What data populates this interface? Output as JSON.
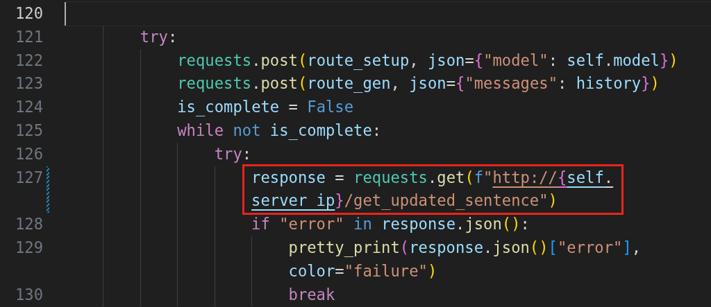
{
  "lines": [
    {
      "number": "120",
      "current": true,
      "modified": false,
      "highlighted": false
    },
    {
      "number": "121",
      "current": false,
      "modified": false,
      "highlighted": false,
      "rows": [
        {
          "tokens": [
            {
              "kind": "kw",
              "text": "try"
            },
            {
              "kind": "p",
              "text": ":"
            }
          ]
        }
      ],
      "children": [
        {
          "number": "122",
          "current": false,
          "modified": false,
          "highlighted": false,
          "rows": [
            {
              "tokens": [
                {
                  "kind": "cls",
                  "text": "requests"
                },
                {
                  "kind": "p",
                  "text": "."
                },
                {
                  "kind": "fn",
                  "text": "post"
                },
                {
                  "kind": "b1",
                  "text": "("
                },
                {
                  "kind": "var",
                  "text": "route_setup"
                },
                {
                  "kind": "p",
                  "text": ", "
                },
                {
                  "kind": "var",
                  "text": "json"
                },
                {
                  "kind": "p",
                  "text": "="
                },
                {
                  "kind": "b2",
                  "text": "{"
                },
                {
                  "kind": "str",
                  "text": "\"model\""
                },
                {
                  "kind": "p",
                  "text": ": "
                },
                {
                  "kind": "var",
                  "text": "self"
                },
                {
                  "kind": "p",
                  "text": "."
                },
                {
                  "kind": "var",
                  "text": "model"
                },
                {
                  "kind": "b2",
                  "text": "}"
                },
                {
                  "kind": "b1",
                  "text": ")"
                }
              ]
            }
          ]
        },
        {
          "number": "123",
          "current": false,
          "modified": false,
          "highlighted": false,
          "rows": [
            {
              "tokens": [
                {
                  "kind": "cls",
                  "text": "requests"
                },
                {
                  "kind": "p",
                  "text": "."
                },
                {
                  "kind": "fn",
                  "text": "post"
                },
                {
                  "kind": "b1",
                  "text": "("
                },
                {
                  "kind": "var",
                  "text": "route_gen"
                },
                {
                  "kind": "p",
                  "text": ", "
                },
                {
                  "kind": "var",
                  "text": "json"
                },
                {
                  "kind": "p",
                  "text": "="
                },
                {
                  "kind": "b2",
                  "text": "{"
                },
                {
                  "kind": "str",
                  "text": "\"messages\""
                },
                {
                  "kind": "p",
                  "text": ": "
                },
                {
                  "kind": "var",
                  "text": "history"
                },
                {
                  "kind": "b2",
                  "text": "}"
                },
                {
                  "kind": "b1",
                  "text": ")"
                }
              ]
            }
          ]
        },
        {
          "number": "124",
          "current": false,
          "modified": false,
          "highlighted": false,
          "rows": [
            {
              "tokens": [
                {
                  "kind": "var",
                  "text": "is_complete"
                },
                {
                  "kind": "p",
                  "text": " = "
                },
                {
                  "kind": "const",
                  "text": "False"
                }
              ]
            }
          ]
        },
        {
          "number": "125",
          "current": false,
          "modified": false,
          "highlighted": false,
          "rows": [
            {
              "tokens": [
                {
                  "kind": "kw",
                  "text": "while "
                },
                {
                  "kind": "const",
                  "text": "not "
                },
                {
                  "kind": "var",
                  "text": "is_complete"
                },
                {
                  "kind": "p",
                  "text": ":"
                }
              ]
            }
          ],
          "children": [
            {
              "number": "126",
              "current": false,
              "modified": false,
              "highlighted": false,
              "rows": [
                {
                  "tokens": [
                    {
                      "kind": "kw",
                      "text": "try"
                    },
                    {
                      "kind": "p",
                      "text": ":"
                    }
                  ]
                }
              ],
              "children": [
                {
                  "number": "127",
                  "current": false,
                  "modified": true,
                  "highlighted": true,
                  "rows": [
                    {
                      "tokens": [
                        {
                          "kind": "var",
                          "text": "response"
                        },
                        {
                          "kind": "p",
                          "text": " = "
                        },
                        {
                          "kind": "cls",
                          "text": "requests"
                        },
                        {
                          "kind": "p",
                          "text": "."
                        },
                        {
                          "kind": "fn",
                          "text": "get"
                        },
                        {
                          "kind": "b1",
                          "text": "("
                        },
                        {
                          "kind": "const",
                          "text": "f"
                        },
                        {
                          "kind": "str",
                          "text": "\""
                        },
                        {
                          "kind": "str",
                          "text": "http://",
                          "underline": true
                        },
                        {
                          "kind": "b2",
                          "text": "{",
                          "underline": true
                        },
                        {
                          "kind": "var",
                          "text": "self",
                          "underline": true
                        },
                        {
                          "kind": "p",
                          "text": ".",
                          "underline": true
                        }
                      ]
                    },
                    {
                      "tokens": [
                        {
                          "kind": "var",
                          "text": "server_ip",
                          "underline": true
                        },
                        {
                          "kind": "b2",
                          "text": "}"
                        },
                        {
                          "kind": "str",
                          "text": "/get_updated_sentence\""
                        },
                        {
                          "kind": "b1",
                          "text": ")"
                        }
                      ]
                    }
                  ]
                },
                {
                  "number": "128",
                  "current": false,
                  "modified": false,
                  "highlighted": false,
                  "rows": [
                    {
                      "tokens": [
                        {
                          "kind": "kw",
                          "text": "if "
                        },
                        {
                          "kind": "str",
                          "text": "\"error\" "
                        },
                        {
                          "kind": "const",
                          "text": "in "
                        },
                        {
                          "kind": "var",
                          "text": "response"
                        },
                        {
                          "kind": "p",
                          "text": "."
                        },
                        {
                          "kind": "fn",
                          "text": "json"
                        },
                        {
                          "kind": "b1",
                          "text": "()"
                        },
                        {
                          "kind": "p",
                          "text": ":"
                        }
                      ]
                    }
                  ],
                  "children": [
                    {
                      "number": "129",
                      "current": false,
                      "modified": false,
                      "highlighted": false,
                      "rows": [
                        {
                          "tokens": [
                            {
                              "kind": "fn",
                              "text": "pretty_print"
                            },
                            {
                              "kind": "b2",
                              "text": "("
                            },
                            {
                              "kind": "var",
                              "text": "response"
                            },
                            {
                              "kind": "p",
                              "text": "."
                            },
                            {
                              "kind": "fn",
                              "text": "json"
                            },
                            {
                              "kind": "b1",
                              "text": "()"
                            },
                            {
                              "kind": "b3",
                              "text": "["
                            },
                            {
                              "kind": "str",
                              "text": "\"error\""
                            },
                            {
                              "kind": "b3",
                              "text": "]"
                            },
                            {
                              "kind": "p",
                              "text": ","
                            }
                          ]
                        },
                        {
                          "tokens": [
                            {
                              "kind": "var",
                              "text": "color"
                            },
                            {
                              "kind": "p",
                              "text": "="
                            },
                            {
                              "kind": "str",
                              "text": "\"failure\""
                            },
                            {
                              "kind": "b1",
                              "text": ")"
                            }
                          ]
                        }
                      ]
                    },
                    {
                      "number": "130",
                      "current": false,
                      "modified": false,
                      "highlighted": false,
                      "rows": [
                        {
                          "tokens": [
                            {
                              "kind": "kw",
                              "text": "break"
                            }
                          ]
                        }
                      ]
                    }
                  ]
                }
              ]
            }
          ]
        }
      ]
    }
  ]
}
